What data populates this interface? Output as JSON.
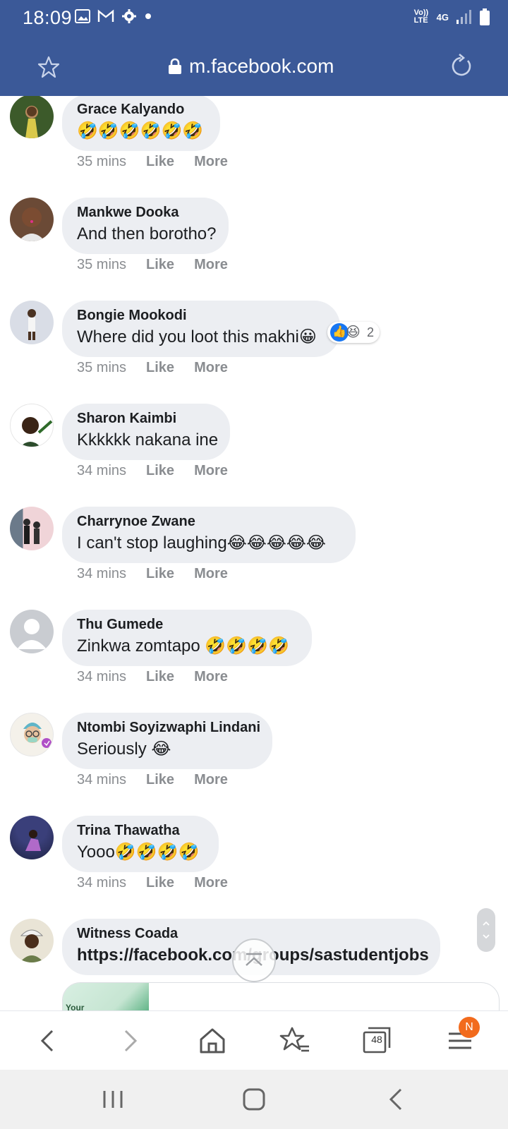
{
  "status_bar": {
    "time": "18:09",
    "icons": [
      "image-icon",
      "gmail-icon",
      "settings-icon",
      "dot-icon",
      "volte-icon",
      "4g-icon",
      "signal-icon",
      "battery-icon"
    ],
    "volte_label": "Vo)) LTE",
    "network_label": "4G"
  },
  "browser": {
    "url": "m.facebook.com",
    "theme_color": "#3b5998",
    "tab_count": "48",
    "menu_badge": "N"
  },
  "comments": [
    {
      "name": "Grace Kalyando",
      "text": "🤣🤣🤣🤣🤣🤣",
      "time": "35 mins",
      "like": "Like",
      "more": "More"
    },
    {
      "name": "Mankwe Dooka",
      "text": "And then borotho?",
      "time": "35 mins",
      "like": "Like",
      "more": "More"
    },
    {
      "name": "Bongie Mookodi",
      "text": "Where did you loot this makhi😀",
      "time": "35 mins",
      "like": "Like",
      "more": "More",
      "reaction_count": "2",
      "reactions": [
        "like-icon",
        "laugh-icon"
      ]
    },
    {
      "name": "Sharon Kaimbi",
      "text": "Kkkkkk nakana ine",
      "time": "34 mins",
      "like": "Like",
      "more": "More"
    },
    {
      "name": "Charrynoe Zwane",
      "text": "I can't stop laughing😂😂😂😂😂",
      "time": "34 mins",
      "like": "Like",
      "more": "More"
    },
    {
      "name": "Thu Gumede",
      "text": "Zinkwa zomtapo 🤣🤣🤣🤣",
      "time": "34 mins",
      "like": "Like",
      "more": "More"
    },
    {
      "name": "Ntombi Soyizwaphi Lindani",
      "text": "Seriously 😂",
      "time": "34 mins",
      "like": "Like",
      "more": "More"
    },
    {
      "name": "Trina Thawatha",
      "text": "Yooo🤣🤣🤣🤣",
      "time": "34 mins",
      "like": "Like",
      "more": "More"
    },
    {
      "name": "Witness Coada",
      "text": "https://facebook.com/groups/sastudentjobs"
    }
  ],
  "link_preview": {
    "thumb_text": "Your"
  }
}
